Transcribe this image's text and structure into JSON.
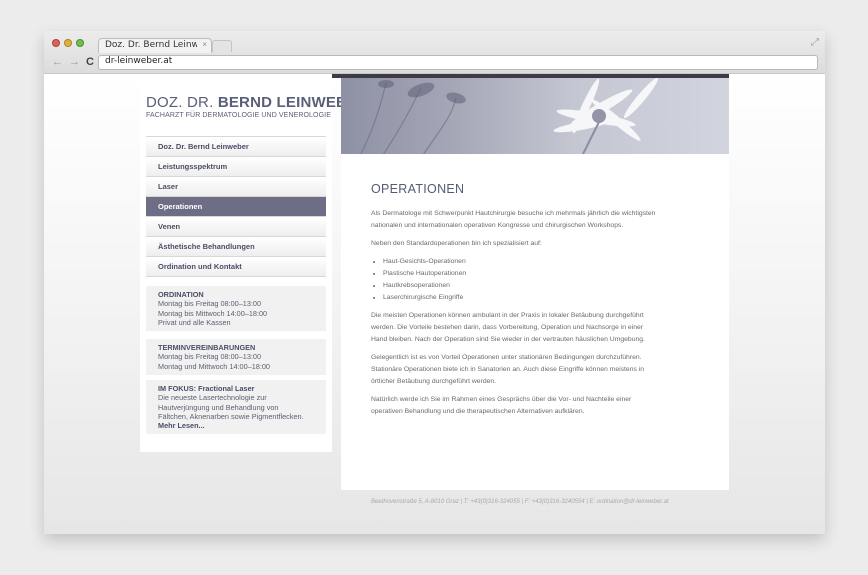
{
  "browser": {
    "tab_title": "Doz. Dr. Bernd Leinwe",
    "tab_close": "×",
    "url": "dr-leinweber.at",
    "back": "←",
    "forward": "→",
    "reload": "C",
    "fullscreen": "⤢"
  },
  "site": {
    "logo": {
      "prefix": "DOZ. DR. ",
      "name": "BERND LEINWEBER",
      "subtitle": "FACHARZT FÜR DERMATOLOGIE UND VENEROLOGIE"
    },
    "menu": [
      {
        "label": "Doz. Dr. Bernd Leinweber",
        "active": false
      },
      {
        "label": "Leistungsspektrum",
        "active": false
      },
      {
        "label": "Laser",
        "active": false
      },
      {
        "label": "Operationen",
        "active": true
      },
      {
        "label": "Venen",
        "active": false
      },
      {
        "label": "Ästhetische Behandlungen",
        "active": false
      },
      {
        "label": "Ordination und Kontakt",
        "active": false
      }
    ],
    "ordination": {
      "title": "ORDINATION",
      "lines": [
        "Montag bis Freitag 08:00–13:00",
        "Montag bis Mittwoch 14:00–18:00",
        "Privat und alle Kassen"
      ]
    },
    "termine": {
      "title": "TERMINVEREINBARUNGEN",
      "lines": [
        "Montag bis Freitag 08:00–13:00",
        "Montag und Mittwoch 14:00–18:00"
      ]
    },
    "fokus": {
      "title": "IM FOKUS: Fractional Laser",
      "lines": [
        "Die neueste Lasertechnologie zur",
        "Hautverjüngung und Behandlung von",
        "Fältchen, Aknenarben sowie Pigmentflecken."
      ],
      "more": "Mehr Lesen..."
    },
    "content": {
      "heading": "OPERATIONEN",
      "p1": "Als Dermatologe mit Schwerpunkt Hautchirurgie besuche ich mehrmals jährlich die wichtigsten nationalen und internationalen operativen Kongresse und chirurgischen Workshops.",
      "p2": "Neben den Standardoperationen bin ich spezialisiert auf:",
      "list": [
        "Haut-Gesichts-Operationen",
        "Plastische Hautoperationen",
        "Hautkrebsoperationen",
        "Laserchirurgische Eingriffe"
      ],
      "p3": "Die meisten Operationen können ambulant in der Praxis in lokaler Betäubung durchgeführt werden. Die Vorteile bestehen darin, dass Vorbereitung, Operation und Nachsorge in einer Hand bleiben. Nach der Operation sind Sie wieder in der vertrauten häuslichen Umgebung.",
      "p4": "Gelegentlich ist es von Vorteil Operationen unter stationären Bedingungen durchzuführen. Stationäre Operationen biete ich in Sanatorien an. Auch diese Eingriffe können meistens in örtlicher Betäubung durchgeführt werden.",
      "p5": "Natürlich werde ich Sie im Rahmen eines Gesprächs über die Vor- und Nachteile einer operativen Behandlung und die therapeutischen Alternativen aufklären."
    },
    "footer": "Beethovenstraße 5, A-8010 Graz | T: +43(0)316-324055 | F: +43(0)316-3240554 | E: ordination@dr-leinweber.at"
  },
  "colors": {
    "accent": "#6d6e86",
    "heading": "#555a78",
    "dark_bar": "#3c3c46"
  }
}
